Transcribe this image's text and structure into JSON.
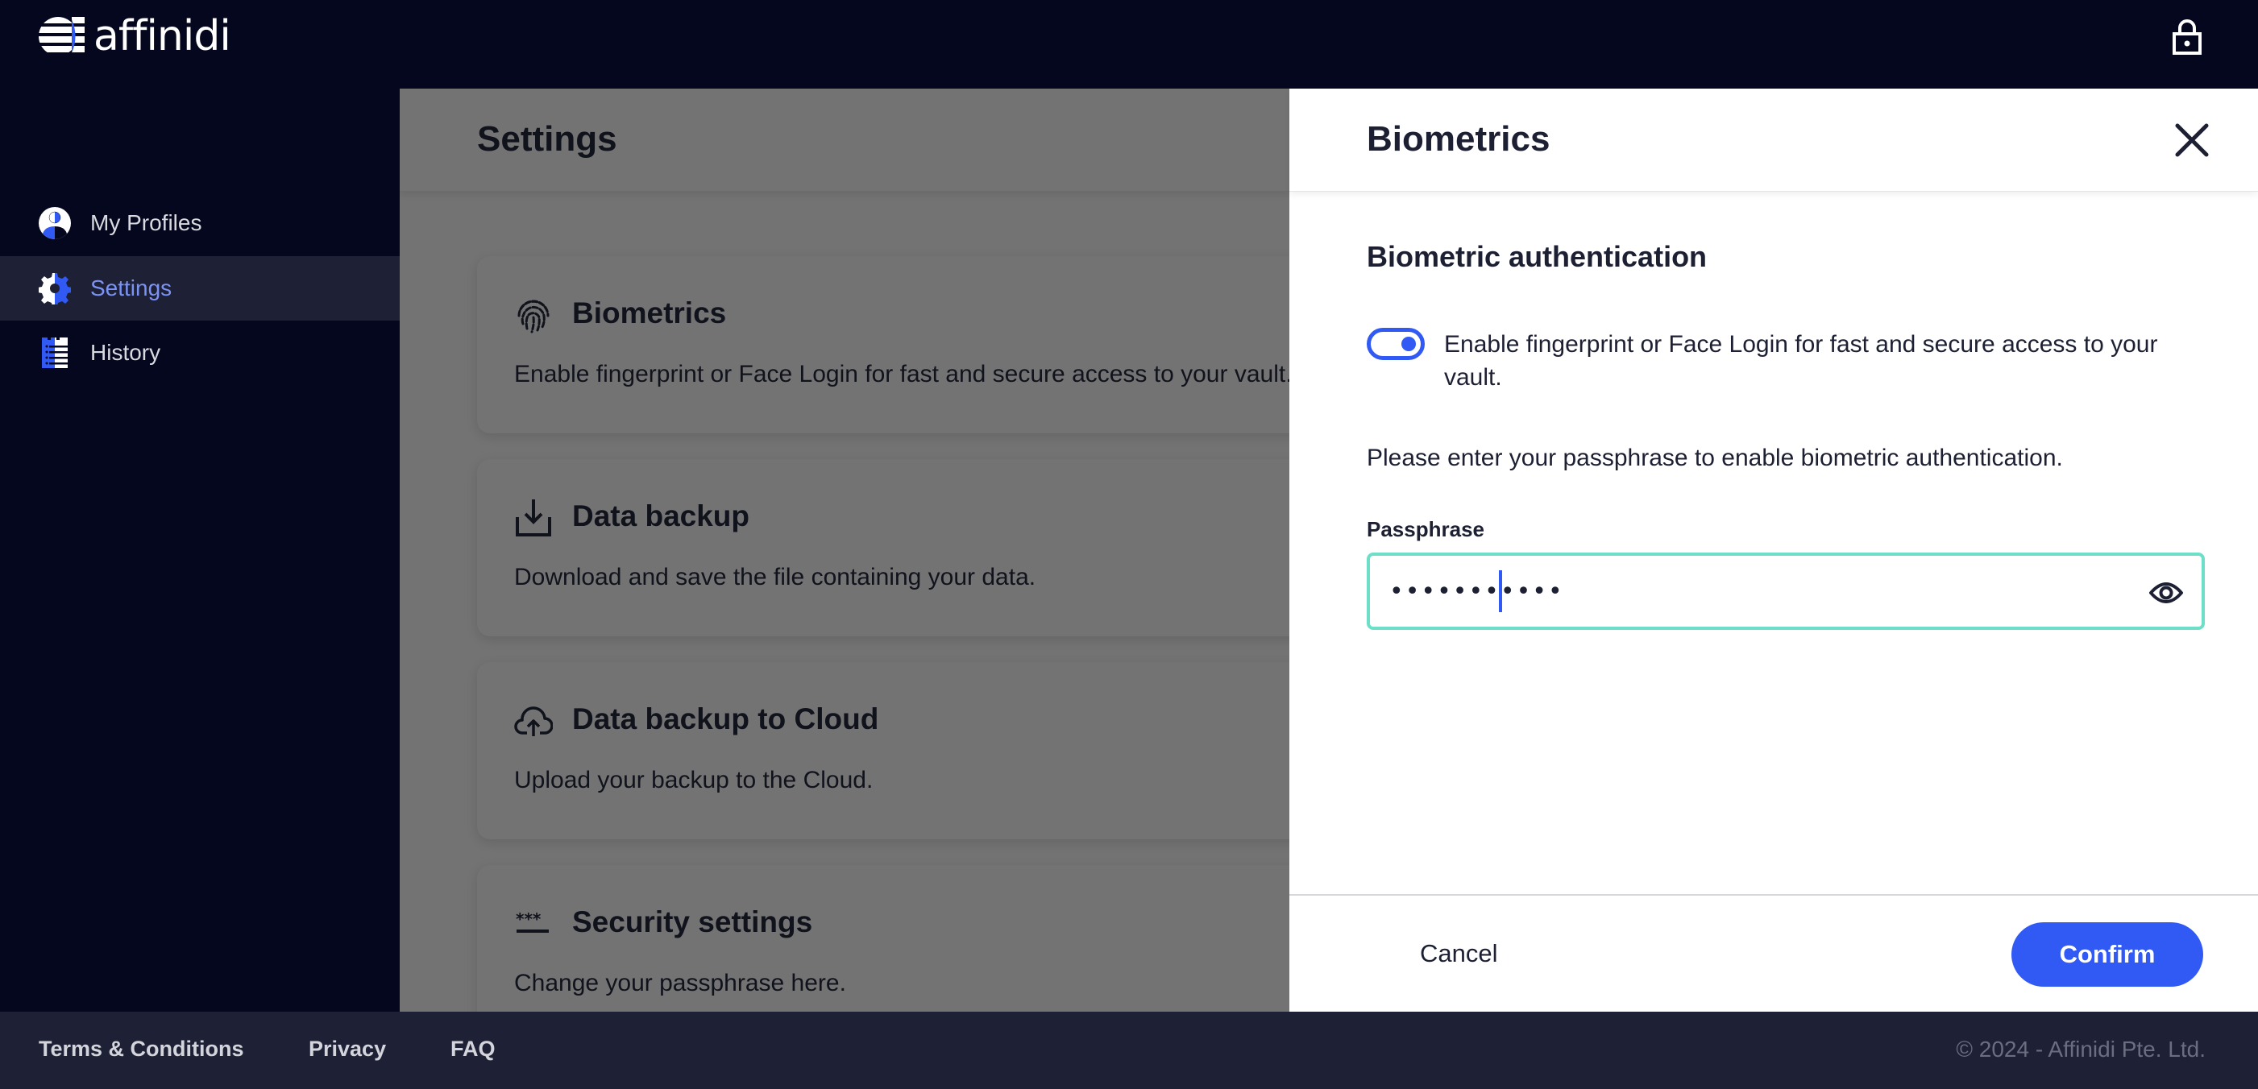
{
  "app": {
    "brand": "affinidi",
    "colors": {
      "background": "#05071f",
      "accent": "#3159f3",
      "input_focus_border": "#6ddfc8",
      "footer_bg": "#1e2035",
      "active_nav_text": "#7b93f5"
    }
  },
  "topbar": {
    "logo_icon": "affinidi-logo-icon",
    "lock_icon": "lock-icon"
  },
  "sidebar": {
    "items": [
      {
        "label": "My Profiles",
        "icon": "user-profile-icon",
        "active": false
      },
      {
        "label": "Settings",
        "icon": "gear-icon",
        "active": true
      },
      {
        "label": "History",
        "icon": "history-list-icon",
        "active": false
      }
    ]
  },
  "main": {
    "title": "Settings",
    "cards": [
      {
        "title": "Biometrics",
        "description": "Enable fingerprint or Face Login for fast and secure access to your vault.",
        "icon": "fingerprint-icon"
      },
      {
        "title": "Data backup",
        "description": "Download and save the file containing your data.",
        "icon": "download-icon"
      },
      {
        "title": "Data backup to Cloud",
        "description": "Upload your backup to the Cloud.",
        "icon": "cloud-upload-icon"
      },
      {
        "title": "Security settings",
        "description": "Change your passphrase here.",
        "icon": "password-icon"
      }
    ]
  },
  "drawer": {
    "title": "Biometrics",
    "close_icon": "close-icon",
    "section_title": "Biometric authentication",
    "toggle": {
      "on": true,
      "label": "Enable fingerprint or Face Login for fast and secure access to your vault."
    },
    "instruction": "Please enter your passphrase to enable biometric authentication.",
    "passphrase": {
      "label": "Passphrase",
      "value": "•••••••••••",
      "masked_length": 11,
      "toggle_visibility_icon": "eye-icon"
    },
    "cancel_label": "Cancel",
    "confirm_label": "Confirm"
  },
  "footer": {
    "links": [
      "Terms & Conditions",
      "Privacy",
      "FAQ"
    ],
    "copyright": "© 2024 - Affinidi Pte. Ltd."
  }
}
